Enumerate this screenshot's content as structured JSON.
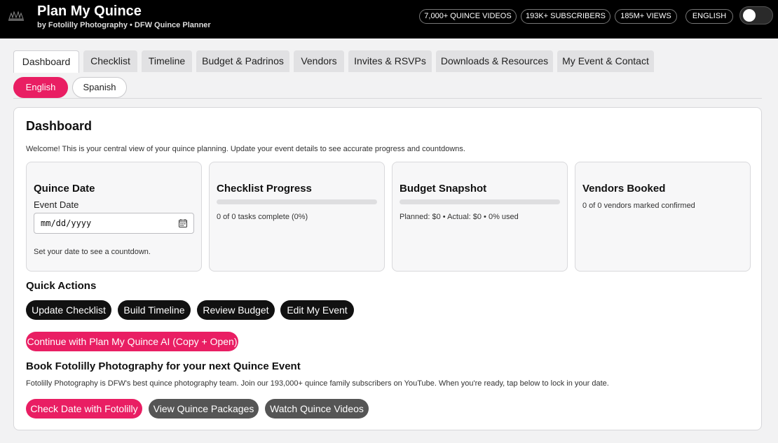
{
  "header": {
    "title": "Plan My Quince",
    "subtitle": "by Fotolilly Photography • DFW Quince Planner",
    "stats": [
      "7,000+ QUINCE VIDEOS",
      "193K+ SUBSCRIBERS",
      "185M+ VIEWS"
    ],
    "language_badge": "ENGLISH",
    "theme_toggle_on": false
  },
  "tabs": [
    {
      "label": "Dashboard",
      "active": true
    },
    {
      "label": "Checklist",
      "active": false
    },
    {
      "label": "Timeline",
      "active": false
    },
    {
      "label": "Budget & Padrinos",
      "active": false
    },
    {
      "label": "Vendors",
      "active": false
    },
    {
      "label": "Invites & RSVPs",
      "active": false
    },
    {
      "label": "Downloads & Resources",
      "active": false
    },
    {
      "label": "My Event & Contact",
      "active": false
    }
  ],
  "languages": {
    "english": "English",
    "spanish": "Spanish",
    "selected": "English"
  },
  "dashboard": {
    "title": "Dashboard",
    "welcome": "Welcome! This is your central view of your quince planning. Update your event details to see accurate progress and countdowns.",
    "cards": {
      "quince_date": {
        "title": "Quince Date",
        "field_label": "Event Date",
        "placeholder": "mm/dd/yyyy",
        "hint": "Set your date to see a countdown."
      },
      "checklist": {
        "title": "Checklist Progress",
        "progress_fraction": 0,
        "status": "0 of 0 tasks complete (0%)"
      },
      "budget": {
        "title": "Budget Snapshot",
        "progress_fraction": 0,
        "status": "Planned: $0 • Actual: $0 • 0% used"
      },
      "vendors": {
        "title": "Vendors Booked",
        "status": "0 of 0 vendors marked confirmed"
      }
    },
    "quick_actions": {
      "title": "Quick Actions",
      "buttons": [
        "Update Checklist",
        "Build Timeline",
        "Review Budget",
        "Edit My Event"
      ],
      "ai_button": "Continue with Plan My Quince AI (Copy + Open)"
    },
    "booking": {
      "title": "Book Fotolilly Photography for your next Quince Event",
      "text": "Fotolilly Photography is DFW's best quince photography team. Join our 193,000+ quince family subscribers on YouTube. When you're ready, tap below to lock in your date.",
      "buttons": [
        "Check Date with Fotolilly",
        "View Quince Packages",
        "Watch Quince Videos"
      ]
    }
  },
  "colors": {
    "accent": "#e91e63",
    "header_bg": "#000000",
    "dark_button": "#111111",
    "gray_button": "#555555"
  },
  "icons": [
    "fotolilly-logo",
    "calendar-icon"
  ]
}
